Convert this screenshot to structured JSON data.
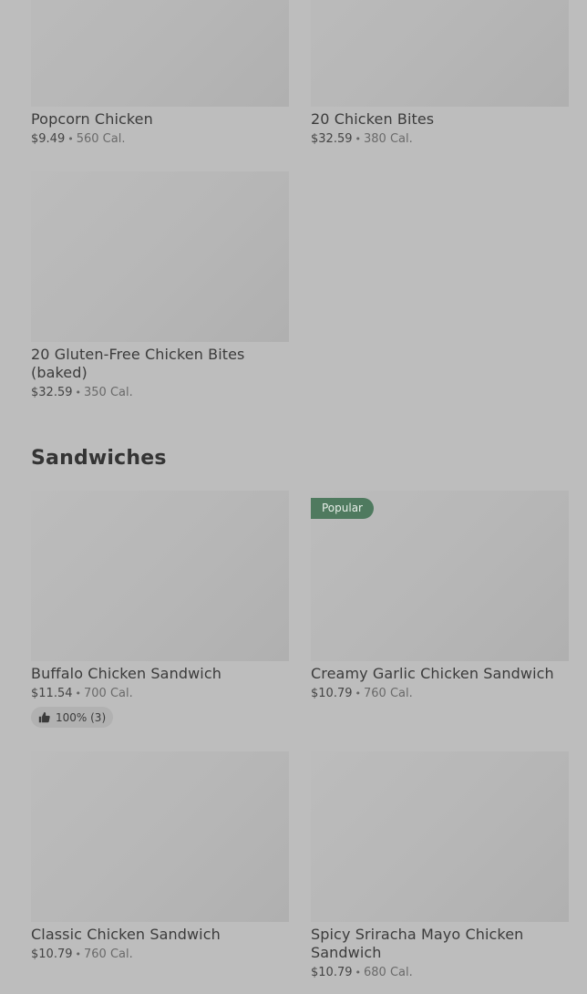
{
  "top_items": [
    {
      "name": "Popcorn Chicken",
      "price": "$9.49",
      "calories": "560 Cal."
    },
    {
      "name": "20 Chicken Bites",
      "price": "$32.59",
      "calories": "380 Cal."
    },
    {
      "name": "20 Gluten-Free Chicken Bites (baked)",
      "price": "$32.59",
      "calories": "350 Cal."
    }
  ],
  "sandwiches": {
    "title": "Sandwiches",
    "items": [
      {
        "name": "Buffalo Chicken Sandwich",
        "price": "$11.54",
        "calories": "700 Cal.",
        "rating": "100% (3)"
      },
      {
        "name": "Creamy Garlic Chicken Sandwich",
        "price": "$10.79",
        "calories": "760 Cal.",
        "badge": "Popular"
      },
      {
        "name": "Classic Chicken Sandwich",
        "price": "$10.79",
        "calories": "760 Cal."
      },
      {
        "name": "Spicy Sriracha Mayo Chicken Sandwich",
        "price": "$10.79",
        "calories": "680 Cal."
      }
    ]
  },
  "separator": "•",
  "icons": {
    "rating": "thumbs-up-icon"
  },
  "colors": {
    "background": "#bdbdbd",
    "badge": "#4f7a5f",
    "text": "#3b3b3b"
  }
}
